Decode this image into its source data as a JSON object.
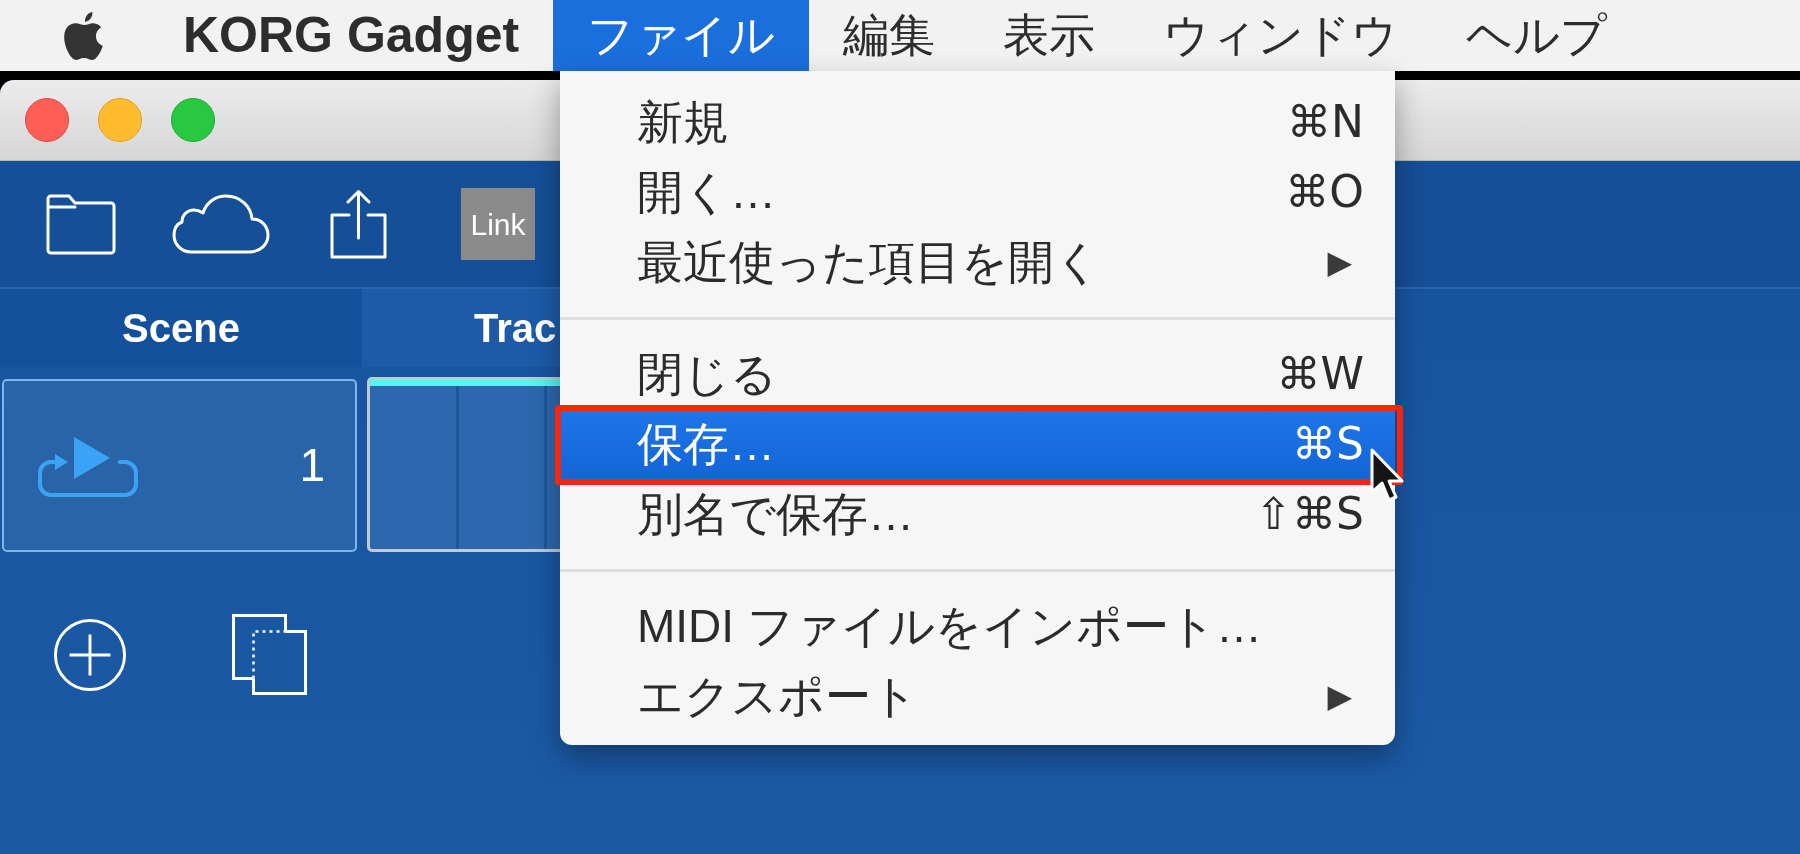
{
  "menu_bar": {
    "app_name": "KORG Gadget",
    "menus": [
      {
        "label": "ファイル",
        "selected": true
      },
      {
        "label": "編集",
        "selected": false
      },
      {
        "label": "表示",
        "selected": false
      },
      {
        "label": "ウィンドウ",
        "selected": false
      },
      {
        "label": "ヘルプ",
        "selected": false
      }
    ]
  },
  "window": {
    "toolbar": {
      "link_label": "Link"
    },
    "columns": [
      {
        "kind": "scene",
        "label": "Scene"
      },
      {
        "kind": "track",
        "label": "Trac"
      }
    ],
    "scene": {
      "number": "1",
      "selected": true
    }
  },
  "file_menu": {
    "items": [
      {
        "kind": "item",
        "label": "新規",
        "shortcut": "⌘N",
        "selected": false,
        "outlined": false
      },
      {
        "kind": "item",
        "label": "開く…",
        "shortcut": "⌘O",
        "selected": false,
        "outlined": false
      },
      {
        "kind": "item",
        "label": "最近使った項目を開く",
        "arrow": "▶",
        "selected": false,
        "outlined": false
      },
      {
        "kind": "separator"
      },
      {
        "kind": "item",
        "label": "閉じる",
        "shortcut": "⌘W",
        "selected": false,
        "outlined": false
      },
      {
        "kind": "item",
        "label": "保存…",
        "shortcut": "⌘S",
        "selected": true,
        "outlined": true
      },
      {
        "kind": "item",
        "label": "別名で保存…",
        "shortcut": "⇧⌘S",
        "selected": false,
        "outlined": false
      },
      {
        "kind": "separator"
      },
      {
        "kind": "item",
        "label": "MIDI ファイルをインポート…",
        "selected": false,
        "outlined": false
      },
      {
        "kind": "item",
        "label": "エクスポート",
        "arrow": "▶",
        "selected": false,
        "outlined": false
      }
    ]
  }
}
